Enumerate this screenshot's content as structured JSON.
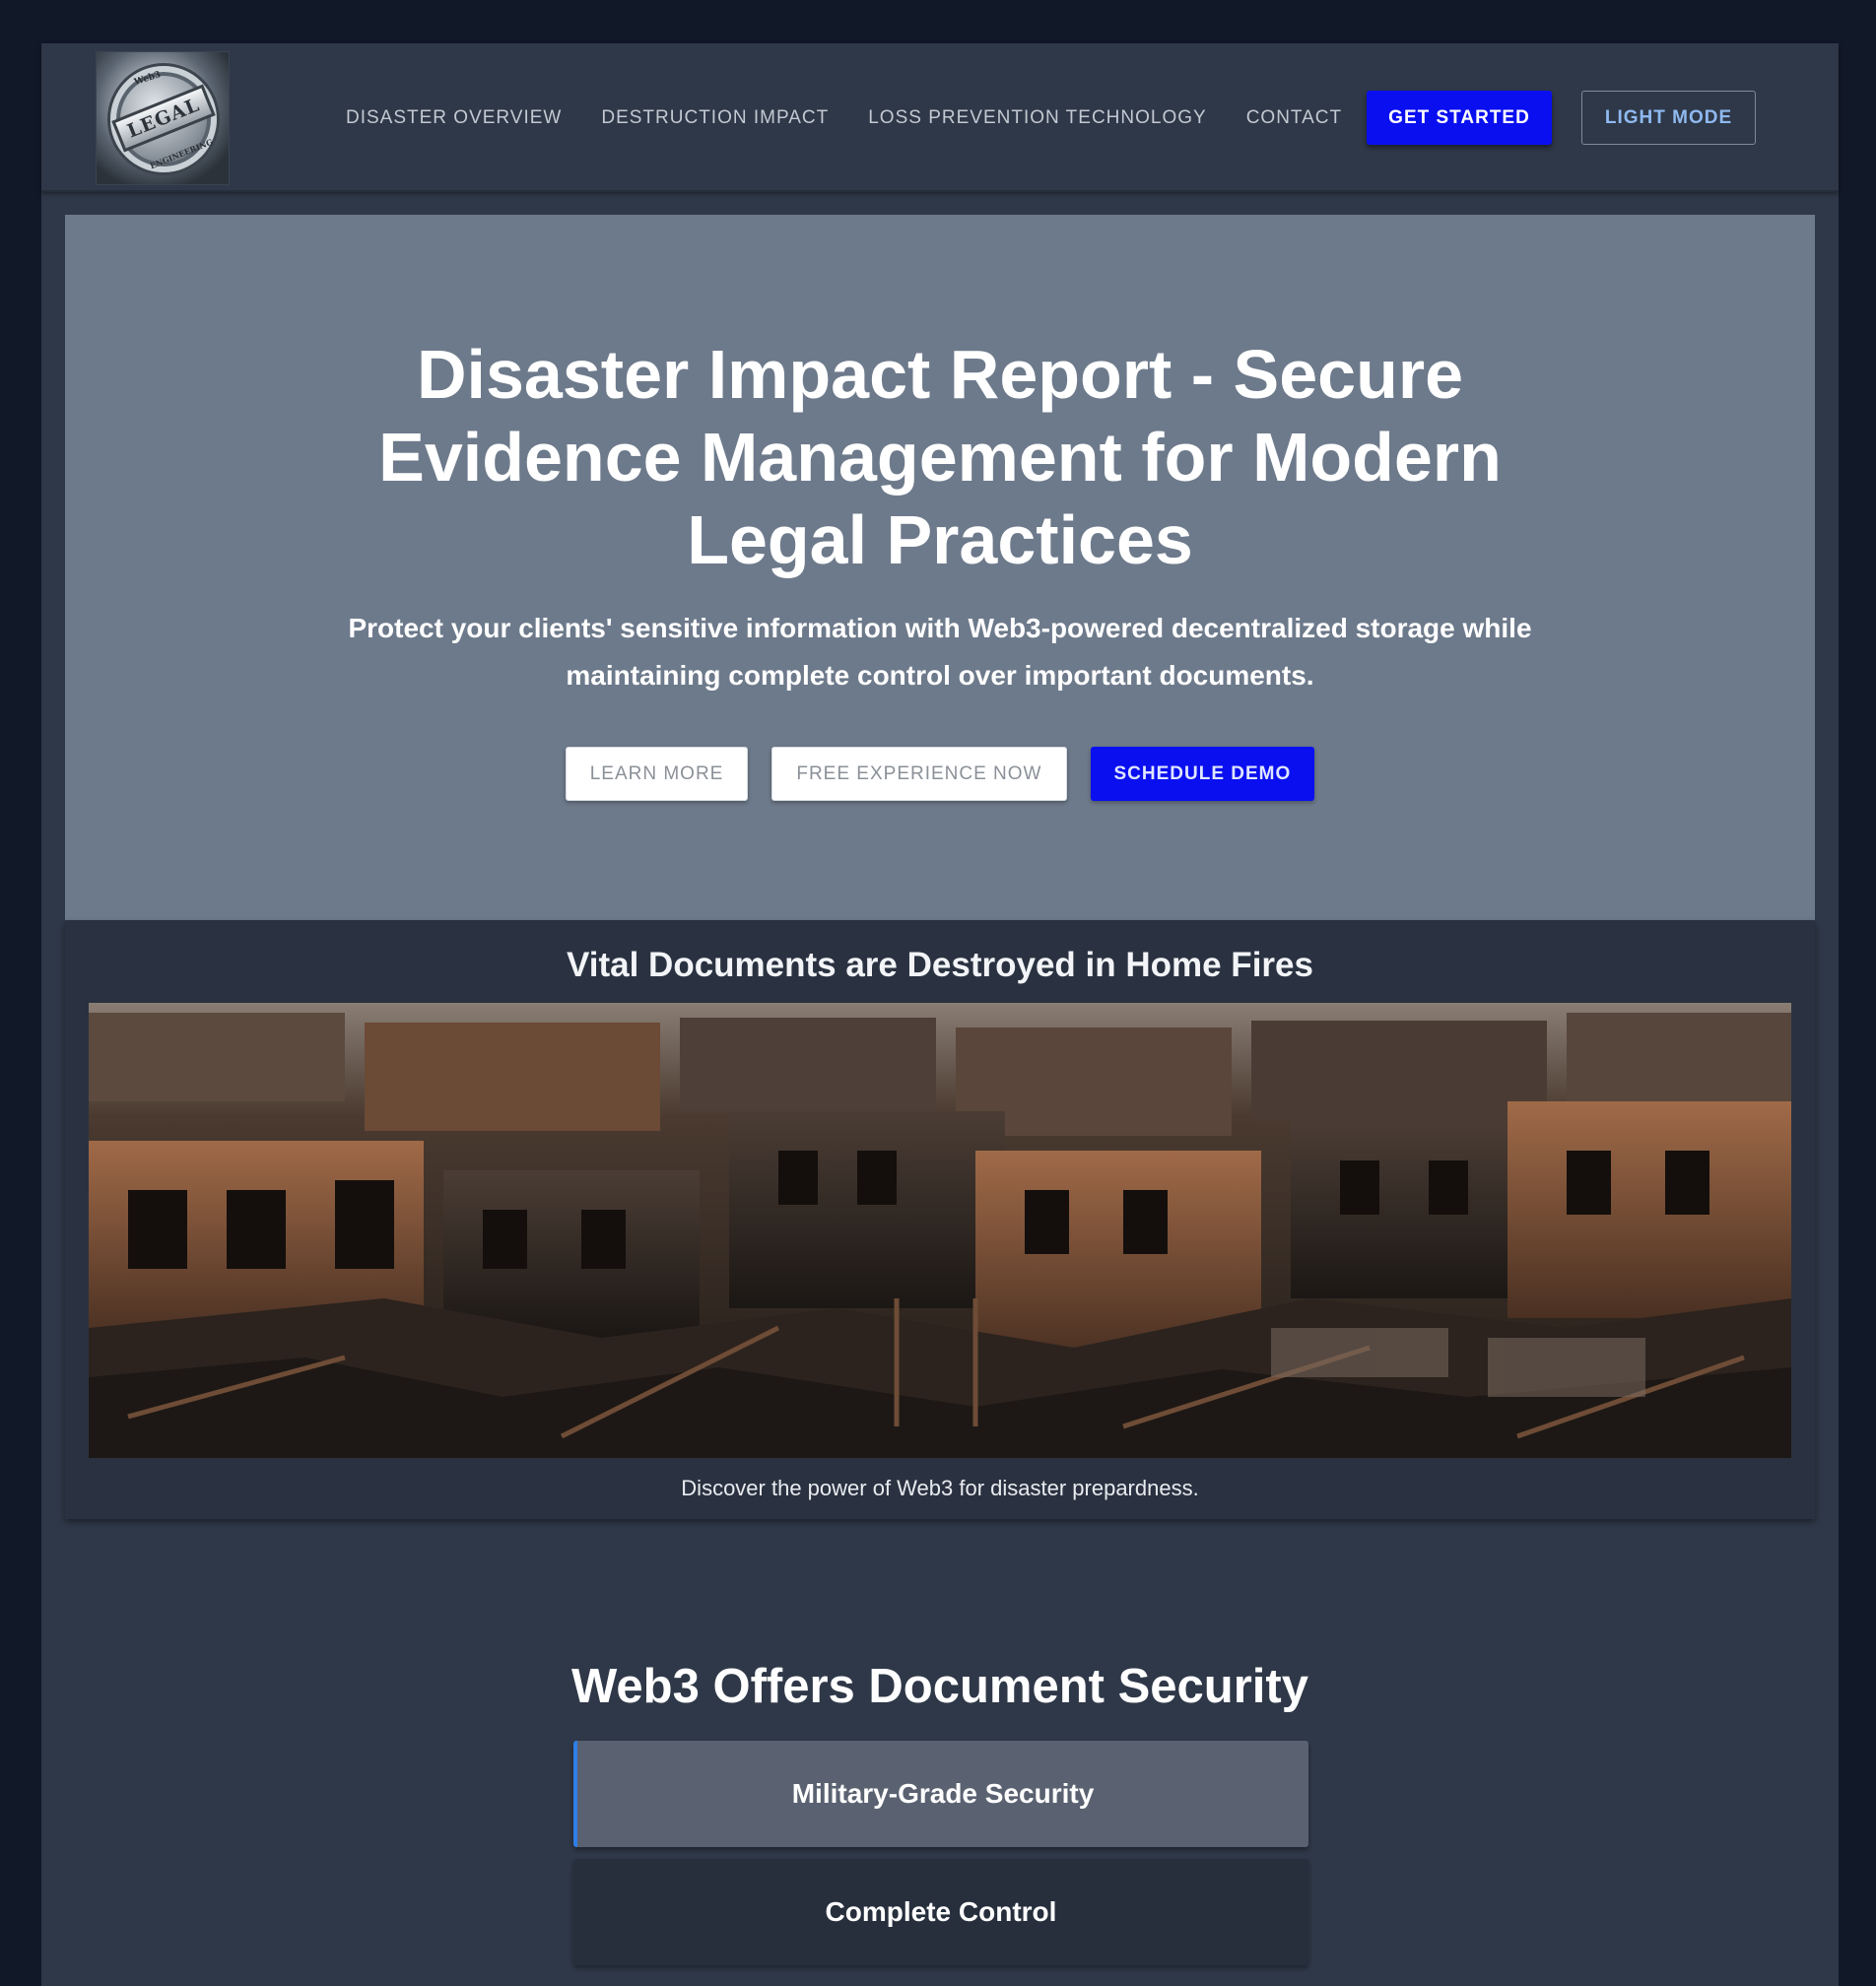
{
  "brand": {
    "logo_text": "LEGAL",
    "logo_top_text": "Web3",
    "logo_bottom_text": "ENGINEERING"
  },
  "nav": {
    "links": [
      "DISASTER OVERVIEW",
      "DESTRUCTION IMPACT",
      "LOSS PREVENTION TECHNOLOGY",
      "CONTACT"
    ],
    "get_started": "GET STARTED",
    "light_mode": "LIGHT MODE"
  },
  "hero": {
    "title": "Disaster Impact Report - Secure Evidence Management for Modern Legal Practices",
    "subtitle": "Protect your clients' sensitive information with Web3-powered decentralized storage while maintaining complete control over important documents.",
    "buttons": {
      "learn_more": "LEARN MORE",
      "free_experience": "FREE EXPERIENCE NOW",
      "schedule_demo": "SCHEDULE DEMO"
    }
  },
  "fire_section": {
    "title": "Vital Documents are Destroyed in Home Fires",
    "caption": "Discover the power of Web3 for disaster prepardness."
  },
  "security": {
    "title": "Web3 Offers Document Security",
    "items": [
      {
        "label": "Military-Grade Security",
        "state": "active"
      },
      {
        "label": "Complete Control",
        "state": "inactive"
      }
    ]
  },
  "colors": {
    "page_bg": "#111827",
    "panel_bg": "#2f3848",
    "hero_bg": "#6d7a8b",
    "primary_button": "#0a0ff0",
    "accent": "#2e7fe8"
  }
}
